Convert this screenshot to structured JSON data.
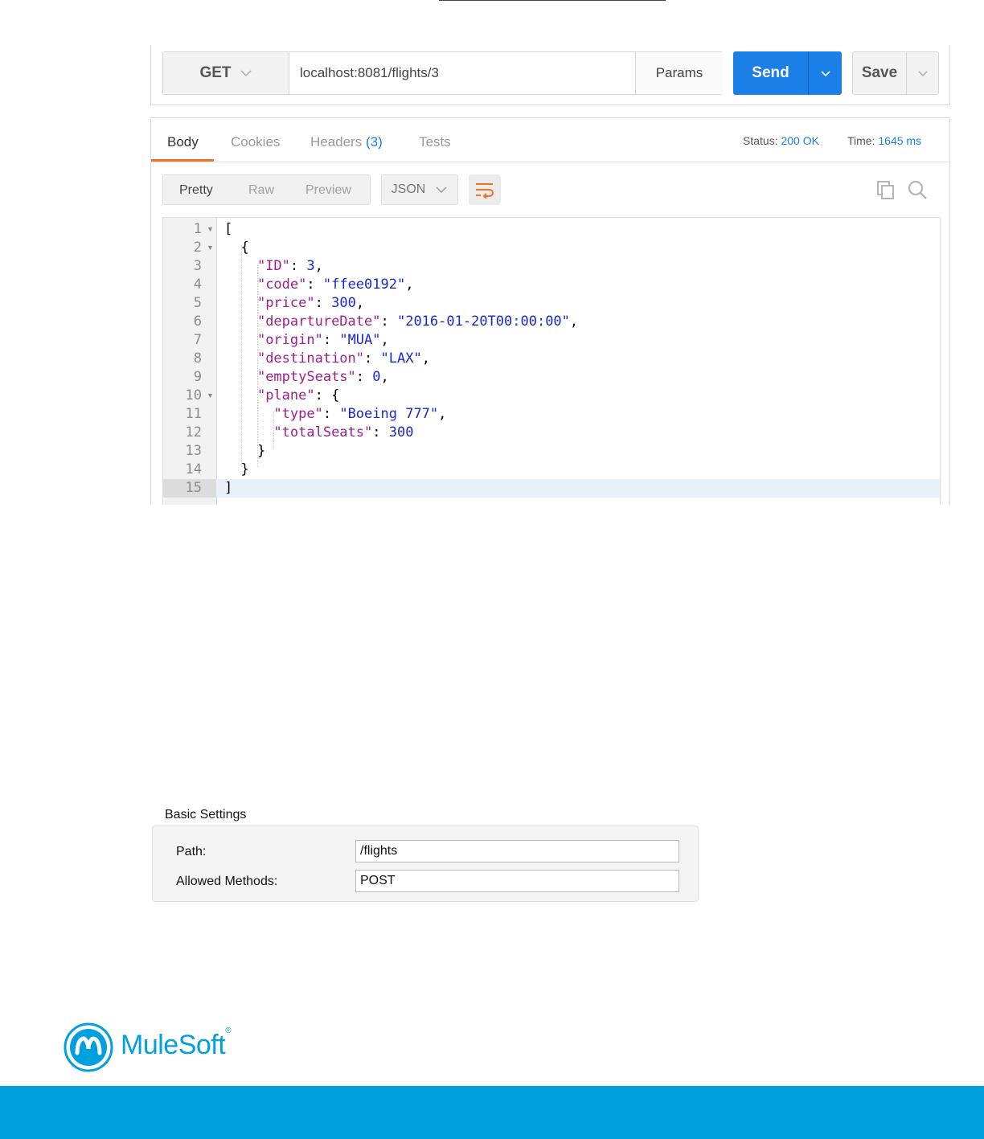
{
  "request": {
    "method": "GET",
    "url": "localhost:8081/flights/3",
    "params_label": "Params",
    "send_label": "Send",
    "save_label": "Save"
  },
  "response": {
    "tabs": [
      {
        "label": "Body",
        "active": true
      },
      {
        "label": "Cookies"
      },
      {
        "label": "Headers",
        "count": "(3)"
      },
      {
        "label": "Tests"
      }
    ],
    "status_label": "Status:",
    "status_value": "200 OK",
    "time_label": "Time:",
    "time_value": "1645 ms",
    "view_modes": [
      "Pretty",
      "Raw",
      "Preview"
    ],
    "format": "JSON",
    "lines": [
      {
        "n": "1",
        "fold": true
      },
      {
        "n": "2",
        "fold": true
      },
      {
        "n": "3"
      },
      {
        "n": "4"
      },
      {
        "n": "5"
      },
      {
        "n": "6"
      },
      {
        "n": "7"
      },
      {
        "n": "8"
      },
      {
        "n": "9"
      },
      {
        "n": "10",
        "fold": true
      },
      {
        "n": "11"
      },
      {
        "n": "12"
      },
      {
        "n": "13"
      },
      {
        "n": "14"
      },
      {
        "n": "15",
        "highlight": true
      }
    ],
    "json": {
      "ID": "3",
      "code": "\"ffee0192\"",
      "price": "300",
      "departureDate": "\"2016-01-20T00:00:00\"",
      "origin": "\"MUA\"",
      "destination": "\"LAX\"",
      "emptySeats": "0",
      "plane_type": "\"Boeing 777\"",
      "plane_totalSeats": "300"
    },
    "keys": {
      "ID": "\"ID\"",
      "code": "\"code\"",
      "price": "\"price\"",
      "departureDate": "\"departureDate\"",
      "origin": "\"origin\"",
      "destination": "\"destination\"",
      "emptySeats": "\"emptySeats\"",
      "plane": "\"plane\"",
      "type": "\"type\"",
      "totalSeats": "\"totalSeats\""
    }
  },
  "settings": {
    "title": "Basic Settings",
    "path_label": "Path:",
    "path_value": "/flights",
    "methods_label": "Allowed Methods:",
    "methods_value": "POST"
  },
  "footer": {
    "brand": "MuleSoft",
    "trademark": "®"
  },
  "colors": {
    "send": "#1a7fe6",
    "accent_tab": "#f47023",
    "brand": "#00a0df"
  }
}
